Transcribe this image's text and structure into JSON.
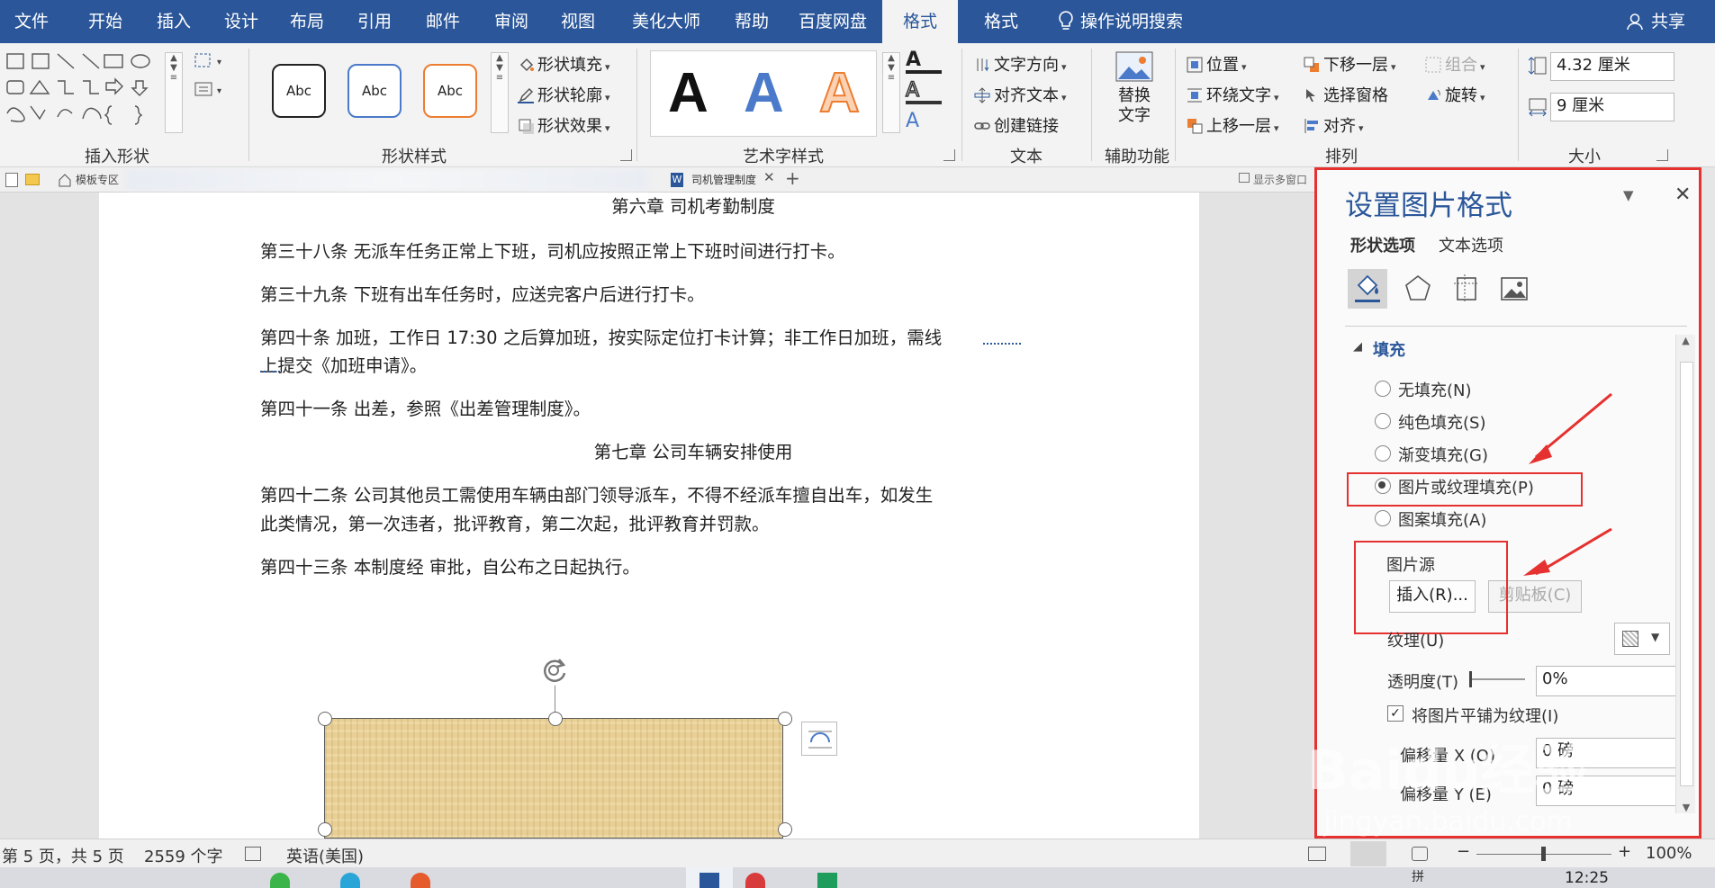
{
  "ribbon_tabs": [
    "文件",
    "开始",
    "插入",
    "设计",
    "布局",
    "引用",
    "邮件",
    "审阅",
    "视图",
    "美化大师",
    "帮助",
    "百度网盘",
    "格式",
    "格式"
  ],
  "search": {
    "label": "操作说明搜索",
    "share": "共享"
  },
  "ribbon": {
    "groups": {
      "insert_shapes": "插入形状",
      "shape_styles": "形状样式",
      "art_styles": "艺术字样式",
      "text": "文本",
      "accessibility": "辅助功能",
      "arrange": "排列",
      "size": "大小"
    },
    "style_preset_label": "Abc",
    "shape_fill": "形状填充",
    "shape_outline": "形状轮廓",
    "shape_effect": "形状效果",
    "art_letter": "A",
    "text_direction": "文字方向",
    "align_text": "对齐文本",
    "create_link": "创建链接",
    "alt_text": "替换\n文字",
    "position": "位置",
    "wrap_text": "环绕文字",
    "bring_forward": "上移一层",
    "send_backward": "下移一层",
    "selection_pane": "选择窗格",
    "align": "对齐",
    "group": "组合",
    "rotate": "旋转",
    "height": "4.32 厘米",
    "width": "9 厘米"
  },
  "doc_tabs": {
    "template": "模板专区",
    "doc_name": "司机管理制度",
    "multi_window": "显示多窗口",
    "add": "+"
  },
  "document": {
    "chapter6": "第六章   司机考勤制度",
    "art38": "第三十八条   无派车任务正常上下班，司机应按照正常上下班时间进行打卡。",
    "art39": "第三十九条   下班有出车任务时，应送完客户后进行打卡。",
    "art40_line1": "第四十条   加班，工作日 17:30 之后算加班，按实际定位打卡计算；非工作日加班，需线",
    "art40_line2": "上提交《加班申请》。",
    "art41": "第四十一条   出差，参照《出差管理制度》。",
    "chapter7": "第七章   公司车辆安排使用",
    "art42_line1": "第四十二条   公司其他员工需使用车辆由部门领导派车，不得不经派车擅自出车，如发生",
    "art42_line2": "此类情况，第一次违者，批评教育，第二次起，批评教育并罚款。",
    "art43": "第四十三条   本制度经   审批，自公布之日起执行。"
  },
  "pane": {
    "title": "设置图片格式",
    "tab_shape": "形状选项",
    "tab_text": "文本选项",
    "section_fill": "填充",
    "opt_none": "无填充(N)",
    "opt_solid": "纯色填充(S)",
    "opt_gradient": "渐变填充(G)",
    "opt_picture": "图片或纹理填充(P)",
    "opt_pattern": "图案填充(A)",
    "picture_source": "图片源",
    "insert_btn": "插入(R)...",
    "clipboard_btn": "剪贴板(C)",
    "texture": "纹理(U)",
    "transparency": "透明度(T)",
    "transparency_value": "0%",
    "tile": "将图片平铺为纹理(I)",
    "offset_x": "偏移量 X (O)",
    "offset_x_value": "0 磅",
    "offset_y": "偏移量 Y (E)",
    "offset_y_value": "0 磅"
  },
  "status": {
    "page": "第 5 页，共 5 页",
    "words": "2559 个字",
    "language": "英语(美国)",
    "zoom": "100%"
  },
  "taskbar": {
    "time": "12:25"
  },
  "watermark": {
    "brand": "Baidu经验",
    "url": "jingyan.baidu.com"
  },
  "colors": {
    "ribbon_blue": "#2b579a",
    "highlight_red": "#e5312f",
    "texture_fill": "#e8cf95"
  }
}
